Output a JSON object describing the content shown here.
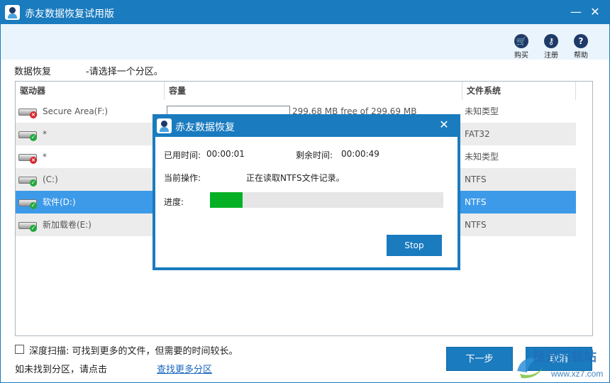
{
  "window": {
    "title": "赤友数据恢复试用版"
  },
  "toolbar": {
    "buy": "购买",
    "register": "注册",
    "help": "帮助"
  },
  "page": {
    "heading": "数据恢复",
    "instruction": "-请选择一个分区。"
  },
  "table": {
    "headers": {
      "drive": "驱动器",
      "capacity": "容量",
      "filesystem": "文件系统"
    },
    "rows": [
      {
        "name": "Secure Area(F:)",
        "capacity": "299.68 MB free of 299.69 MB",
        "capacity_used_fraction": 0.0,
        "fs": "未知类型",
        "status": "error"
      },
      {
        "name": "*",
        "capacity": "",
        "fs": "FAT32",
        "status": "ok"
      },
      {
        "name": "*",
        "capacity": "",
        "fs": "未知类型",
        "status": "error"
      },
      {
        "name": "(C:)",
        "capacity": "",
        "fs": "NTFS",
        "status": "ok"
      },
      {
        "name": "软件(D:)",
        "capacity": "",
        "fs": "NTFS",
        "status": "ok",
        "selected": true
      },
      {
        "name": "新加载卷(E:)",
        "capacity": "",
        "fs": "NTFS",
        "status": "ok"
      }
    ]
  },
  "options": {
    "deep_scan_label": "深度扫描: 可找到更多的文件，但需要的时间较长。",
    "deep_scan_checked": false
  },
  "footer": {
    "not_found_text": "如未找到分区，请点击",
    "find_more_link": "查找更多分区"
  },
  "buttons": {
    "next": "下一步",
    "cancel": "取消"
  },
  "watermark": {
    "text": "极光下载站",
    "url": "www.xz7.com"
  },
  "dialog": {
    "title": "赤友数据恢复",
    "elapsed_label": "已用时间:",
    "elapsed_value": "00:00:01",
    "remaining_label": "剩余时间:",
    "remaining_value": "00:00:49",
    "operation_label": "当前操作:",
    "operation_value": "正在读取NTFS文件记录。",
    "progress_label": "进度:",
    "progress_fraction": 0.14,
    "stop_button": "Stop"
  },
  "colors": {
    "accent": "#1a7bbf",
    "selection": "#3d9ae9",
    "progress": "#06b025",
    "link": "#1a66c2"
  }
}
